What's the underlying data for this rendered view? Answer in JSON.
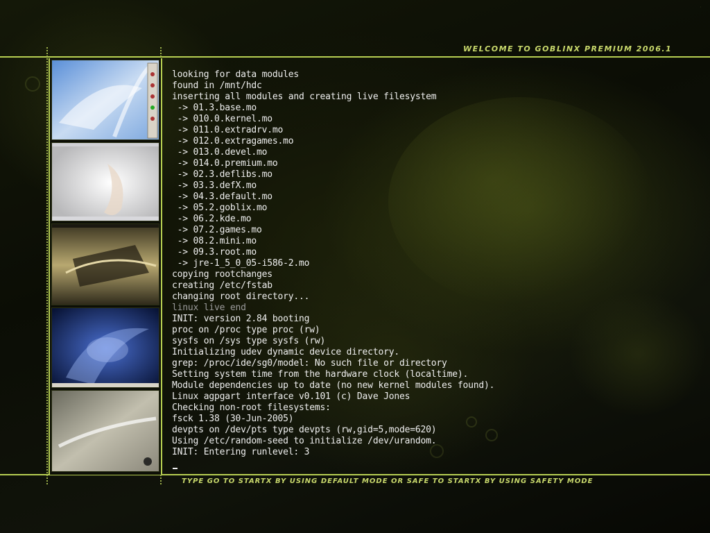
{
  "header": {
    "title": "WELCOME TO GOBLINX PREMIUM 2006.1"
  },
  "footer": {
    "hint": "TYPE GO TO STARTX BY USING DEFAULT MODE OR SAFE TO STARTX  BY USING SAFETY MODE"
  },
  "console": {
    "lines": [
      "looking for data modules",
      "found in /mnt/hdc",
      "inserting all modules and creating live filesystem",
      " -> 01.3.base.mo",
      " -> 010.0.kernel.mo",
      " -> 011.0.extradrv.mo",
      " -> 012.0.extragames.mo",
      " -> 013.0.devel.mo",
      " -> 014.0.premium.mo",
      " -> 02.3.deflibs.mo",
      " -> 03.3.defX.mo",
      " -> 04.3.default.mo",
      " -> 05.2.goblix.mo",
      " -> 06.2.kde.mo",
      " -> 07.2.games.mo",
      " -> 08.2.mini.mo",
      " -> 09.3.root.mo",
      " -> jre-1_5_0_05-i586-2.mo",
      "copying rootchanges",
      "creating /etc/fstab",
      "changing root directory...",
      "linux live end",
      "INIT: version 2.84 booting",
      "proc on /proc type proc (rw)",
      "sysfs on /sys type sysfs (rw)",
      "Initializing udev dynamic device directory.",
      "grep: /proc/ide/sg0/model: No such file or directory",
      "Setting system time from the hardware clock (localtime).",
      "Module dependencies up to date (no new kernel modules found).",
      "Linux agpgart interface v0.101 (c) Dave Jones",
      "Checking non-root filesystems:",
      "fsck 1.38 (30-Jun-2005)",
      "devpts on /dev/pts type devpts (rw,gid=5,mode=620)",
      "Using /etc/random-seed to initialize /dev/urandom.",
      "INIT: Entering runlevel: 3"
    ],
    "dim_lines": [
      21
    ]
  },
  "colors": {
    "accent": "#b7cf52",
    "banner": "#c9d96c",
    "text": "#f0f0f0",
    "dim": "#9a9a9a"
  }
}
